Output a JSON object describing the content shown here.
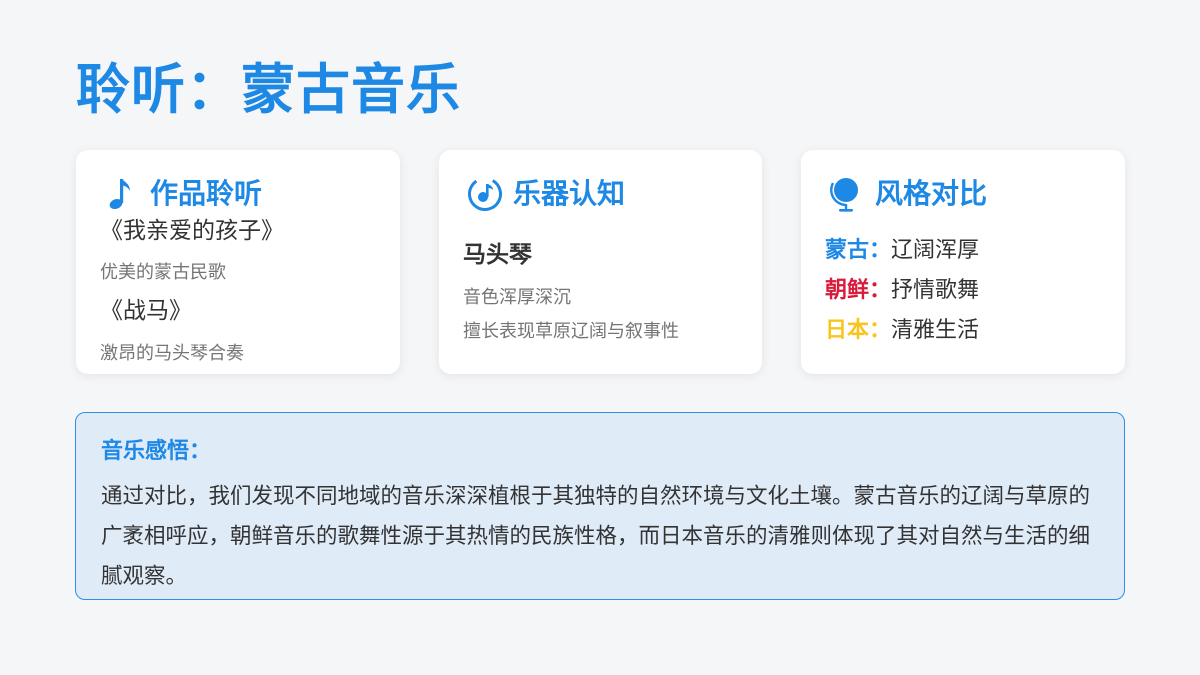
{
  "title": "聆听：蒙古音乐",
  "cards": {
    "listening": {
      "heading": "作品聆听",
      "icon": "music-note-icon",
      "songs": [
        {
          "name": "《我亲爱的孩子》",
          "desc": "优美的蒙古民歌"
        },
        {
          "name": "《战马》",
          "desc": "激昂的马头琴合奏"
        }
      ]
    },
    "instrument": {
      "heading": "乐器认知",
      "icon": "music-disc-icon",
      "name": "马头琴",
      "lines": [
        "音色浑厚深沉",
        "擅长表现草原辽阔与叙事性"
      ]
    },
    "style": {
      "heading": "风格对比",
      "icon": "globe-icon",
      "rows": [
        {
          "key": "蒙古：",
          "value": "辽阔浑厚",
          "color": "#1e88e5"
        },
        {
          "key": "朝鲜：",
          "value": "抒情歌舞",
          "color": "#d81b3a"
        },
        {
          "key": "日本：",
          "value": "清雅生活",
          "color": "#f9c51d"
        }
      ]
    }
  },
  "insight": {
    "title": "音乐感悟：",
    "body": "通过对比，我们发现不同地域的音乐深深植根于其独特的自然环境与文化土壤。蒙古音乐的辽阔与草原的广袤相呼应，朝鲜音乐的歌舞性源于其热情的民族性格，而日本音乐的清雅则体现了其对自然与生活的细腻观察。"
  },
  "colors": {
    "accent": "#1e88e5",
    "background": "#f5f6f8",
    "insight_bg": "#e0ebf8"
  }
}
